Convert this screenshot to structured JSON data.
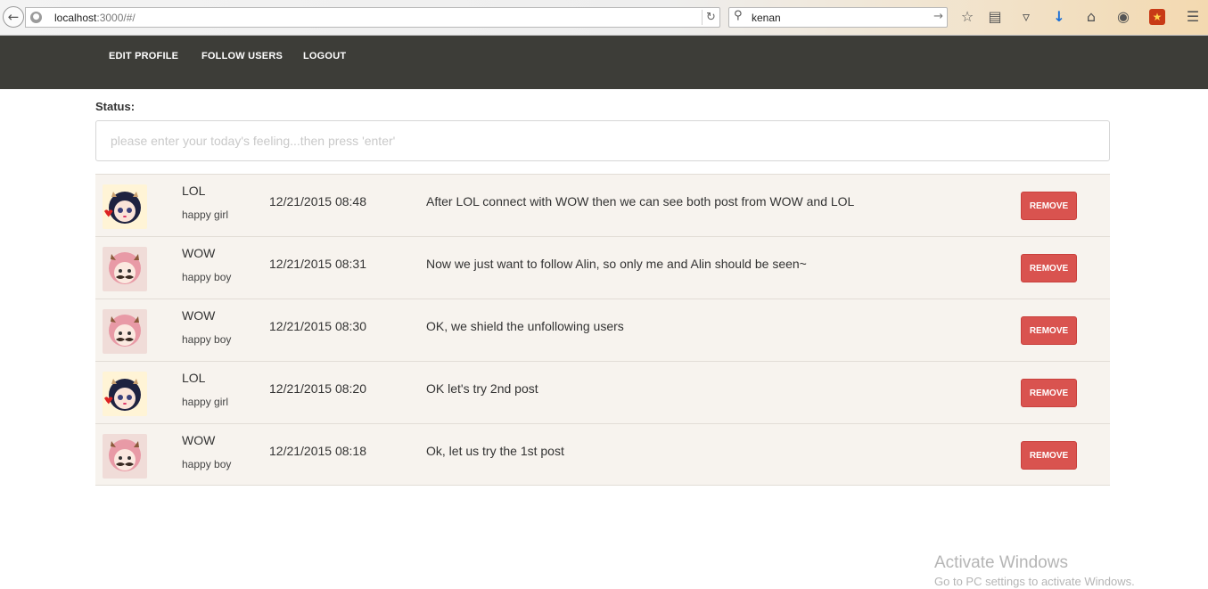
{
  "browser": {
    "url_host": "localhost",
    "url_rest": ":3000/#/",
    "search_query": "kenan"
  },
  "nav": {
    "items": [
      "EDIT PROFILE",
      "FOLLOW USERS",
      "LOGOUT"
    ]
  },
  "status": {
    "label": "Status:",
    "placeholder": "please enter your today's feeling...then press 'enter'"
  },
  "posts": [
    {
      "user": "LOL",
      "mood": "happy girl",
      "time": "12/21/2015 08:48",
      "text": "After LOL connect with WOW then we can see both post from WOW and LOL",
      "button": "REMOVE",
      "avatar": "girl-avatar"
    },
    {
      "user": "WOW",
      "mood": "happy boy",
      "time": "12/21/2015 08:31",
      "text": "Now we just want to follow Alin, so only me and Alin should be seen~",
      "button": "REMOVE",
      "avatar": "boy-avatar"
    },
    {
      "user": "WOW",
      "mood": "happy boy",
      "time": "12/21/2015 08:30",
      "text": "OK, we shield the unfollowing users",
      "button": "REMOVE",
      "avatar": "boy-avatar"
    },
    {
      "user": "LOL",
      "mood": "happy girl",
      "time": "12/21/2015 08:20",
      "text": "OK let's try 2nd post",
      "button": "REMOVE",
      "avatar": "girl-avatar"
    },
    {
      "user": "WOW",
      "mood": "happy boy",
      "time": "12/21/2015 08:18",
      "text": "Ok, let us try the 1st post",
      "button": "REMOVE",
      "avatar": "boy-avatar"
    }
  ],
  "watermark": {
    "title": "Activate Windows",
    "subtitle": "Go to PC settings to activate Windows."
  },
  "colors": {
    "navbar": "#3d3d38",
    "row_bg": "#f7f3ee",
    "remove_button": "#d9534f"
  }
}
